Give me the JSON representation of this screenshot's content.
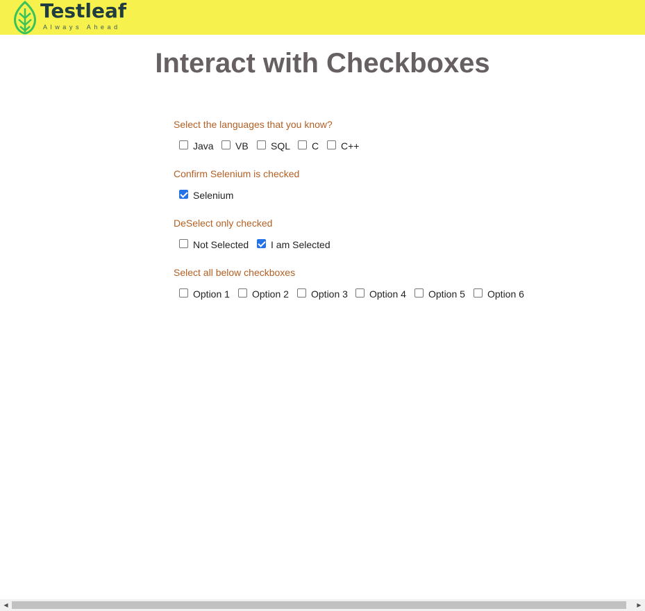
{
  "brand": {
    "name": "Testleaf",
    "tagline": "Always Ahead",
    "colors": {
      "topbar": "#f6f14c",
      "wordmark": "#1f3d40",
      "leaf": "#39c25b"
    }
  },
  "page": {
    "title": "Interact with Checkboxes"
  },
  "colors": {
    "section_label": "#b35f23",
    "title": "#666063",
    "checked": "#2372e8"
  },
  "sections": [
    {
      "label": "Select the languages that you know?",
      "options": [
        {
          "label": "Java",
          "checked": false
        },
        {
          "label": "VB",
          "checked": false
        },
        {
          "label": "SQL",
          "checked": false
        },
        {
          "label": "C",
          "checked": false
        },
        {
          "label": "C++",
          "checked": false
        }
      ]
    },
    {
      "label": "Confirm Selenium is checked",
      "options": [
        {
          "label": "Selenium",
          "checked": true
        }
      ]
    },
    {
      "label": "DeSelect only checked",
      "options": [
        {
          "label": "Not Selected",
          "checked": false
        },
        {
          "label": "I am Selected",
          "checked": true
        }
      ]
    },
    {
      "label": "Select all below checkboxes",
      "options": [
        {
          "label": "Option 1",
          "checked": false
        },
        {
          "label": "Option 2",
          "checked": false
        },
        {
          "label": "Option 3",
          "checked": false
        },
        {
          "label": "Option 4",
          "checked": false
        },
        {
          "label": "Option 5",
          "checked": false
        },
        {
          "label": "Option 6",
          "checked": false
        }
      ]
    }
  ],
  "scrollbar": {
    "left_icon": "arrow-left-icon",
    "right_icon": "arrow-right-icon"
  }
}
